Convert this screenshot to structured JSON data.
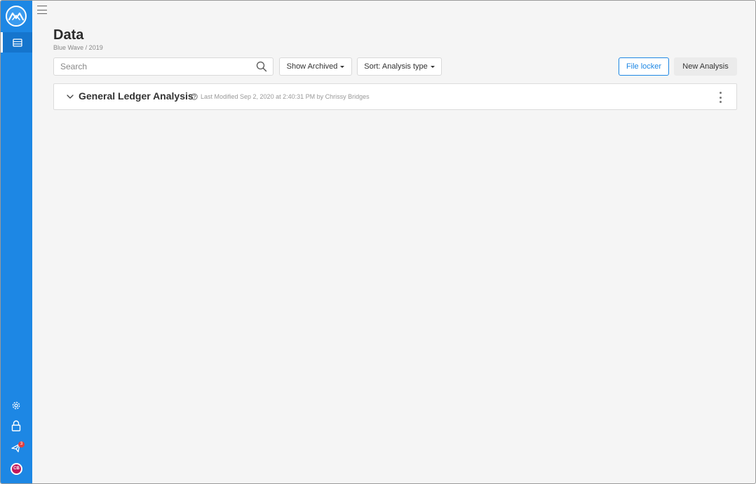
{
  "header": {
    "title": "Data",
    "breadcrumb": "Blue Wave / 2019"
  },
  "toolbar": {
    "search_placeholder": "Search",
    "show_archived_label": "Show Archived",
    "sort_label": "Sort: Analysis type",
    "file_locker_label": "File locker",
    "new_analysis_label": "New Analysis"
  },
  "analyses": [
    {
      "name": "General Ledger Analysis",
      "meta": "Last Modified Sep 2, 2020 at 2:40:31 PM by Chrissy Bridges"
    }
  ],
  "sidebar": {
    "notification_count": "3",
    "user_initials": "CB",
    "icons": [
      "logo-icon",
      "data-icon",
      "settings-icon",
      "lock-icon",
      "notifications-icon",
      "avatar"
    ]
  },
  "colors": {
    "sidebar": "#1d87e4",
    "accent": "#1d87e4",
    "badge": "#e04141",
    "avatar": "#c2185b"
  }
}
